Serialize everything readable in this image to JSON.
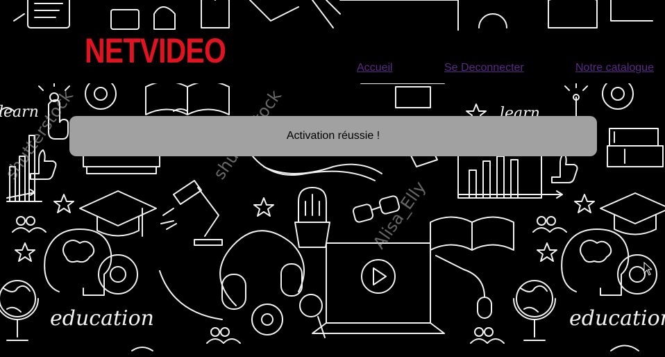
{
  "brand": {
    "logo_text": "NETVIDEO",
    "logo_color": "#e21220"
  },
  "nav": {
    "home": "Accueil",
    "logout": "Se Deconnecter",
    "catalogue": "Notre catalogue",
    "link_color": "#5b2a86"
  },
  "message": {
    "text": "Activation réussie !",
    "box_color": "#a1a1a1"
  },
  "background": {
    "theme": "education doodles on black",
    "words": [
      "education",
      "education",
      "learn",
      "learn"
    ],
    "watermark": "Alisa_Elly",
    "icons": [
      "book-icon",
      "laptop-play-icon",
      "headphones-icon",
      "globe-icon",
      "gear-icon",
      "lightbulb-icon",
      "graduation-cap-icon",
      "cactus-icon",
      "desk-lamp-icon",
      "magnifier-icon",
      "bar-chart-icon",
      "thumbs-up-icon",
      "glasses-icon",
      "mouse-icon",
      "star-icon",
      "brain-head-icon",
      "cursor-hand-icon"
    ]
  }
}
